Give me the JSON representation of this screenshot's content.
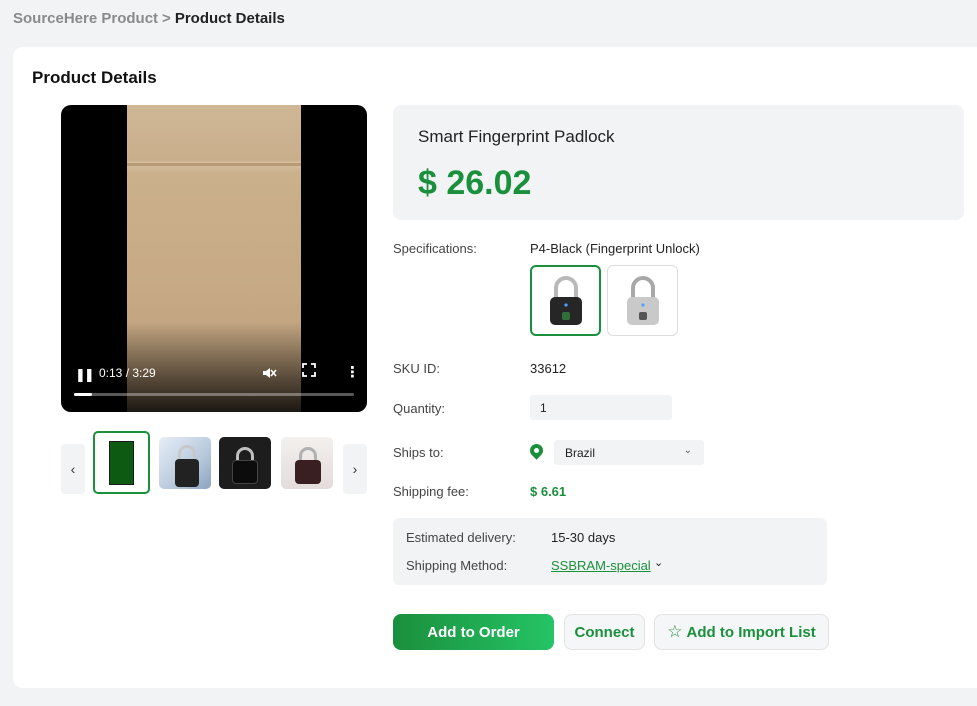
{
  "breadcrumb": {
    "parent": "SourceHere Product",
    "separator": ">",
    "current": "Product Details"
  },
  "card": {
    "title": "Product Details"
  },
  "video": {
    "time": "0:13 / 3:29",
    "progress_fraction": 0.065,
    "icons": [
      "pause-icon",
      "muted-icon",
      "fullscreen-icon",
      "more-vertical-icon"
    ]
  },
  "thumbnails": {
    "prev_glyph": "‹",
    "next_glyph": "›"
  },
  "product": {
    "name": "Smart Fingerprint Padlock",
    "price": "$ 26.02"
  },
  "specifications": {
    "label": "Specifications:",
    "selected": "P4-Black (Fingerprint Unlock)"
  },
  "sku": {
    "label": "SKU ID:",
    "value": "33612"
  },
  "quantity": {
    "label": "Quantity:",
    "value": "1"
  },
  "ships_to": {
    "label": "Ships to:",
    "country": "Brazil",
    "chevron": "⌄"
  },
  "shipping_fee": {
    "label": "Shipping fee:",
    "value": "$ 6.61"
  },
  "delivery": {
    "estimated_label": "Estimated delivery:",
    "estimated_value": "15-30 days",
    "method_label": "Shipping Method:",
    "method_value": "SSBRAM-special",
    "method_chevron": "⌄"
  },
  "actions": {
    "add_to_order": "Add to Order",
    "connect": "Connect",
    "add_to_import_list": "Add to Import List",
    "star_glyph": "☆"
  },
  "colors": {
    "accent": "#1a8f3c",
    "panel_bg": "#f2f3f5"
  }
}
